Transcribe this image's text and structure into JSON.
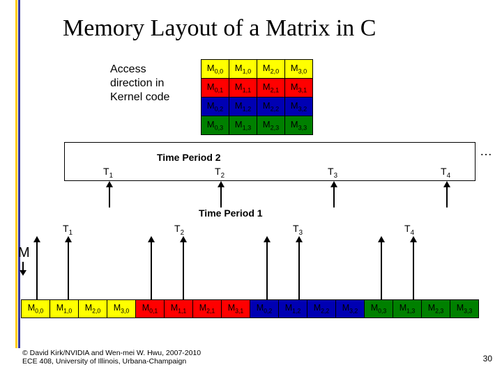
{
  "title": "Memory Layout of a Matrix in C",
  "access_label": "Access direction in Kernel code",
  "matrix_rows": [
    [
      "M0,0",
      "M1,0",
      "M2,0",
      "M3,0"
    ],
    [
      "M0,1",
      "M1,1",
      "M2,1",
      "M3,1"
    ],
    [
      "M0,2",
      "M1,2",
      "M2,2",
      "M3,2"
    ],
    [
      "M0,3",
      "M1,3",
      "M2,3",
      "M3,3"
    ]
  ],
  "tp2_label": "Time Period 2",
  "tp1_label": "Time Period 1",
  "ellipsis": "…",
  "threads": [
    "T1",
    "T2",
    "T3",
    "T4"
  ],
  "M_label": "M",
  "linear": [
    "M0,0",
    "M1,0",
    "M2,0",
    "M3,0",
    "M0,1",
    "M1,1",
    "M2,1",
    "M3,1",
    "M0,2",
    "M1,2",
    "M2,2",
    "M3,2",
    "M0,3",
    "M1,3",
    "M2,3",
    "M3,3"
  ],
  "footer_line1": "© David Kirk/NVIDIA and Wen-mei W. Hwu, 2007-2010",
  "footer_line2": "ECE 408, University of Illinois, Urbana-Champaign",
  "page_number": "30",
  "chart_data": {
    "type": "table",
    "title": "Memory Layout of a Matrix in C",
    "matrix_4x4": [
      [
        "M0,0",
        "M1,0",
        "M2,0",
        "M3,0"
      ],
      [
        "M0,1",
        "M1,1",
        "M2,1",
        "M3,1"
      ],
      [
        "M0,2",
        "M1,2",
        "M2,2",
        "M3,2"
      ],
      [
        "M0,3",
        "M1,3",
        "M2,3",
        "M3,3"
      ]
    ],
    "row_colors": [
      "#ffff00",
      "#ff0000",
      "#0000b3",
      "#008000"
    ],
    "linear_layout": [
      "M0,0",
      "M1,0",
      "M2,0",
      "M3,0",
      "M0,1",
      "M1,1",
      "M2,1",
      "M3,1",
      "M0,2",
      "M1,2",
      "M2,2",
      "M3,2",
      "M0,3",
      "M1,3",
      "M2,3",
      "M3,3"
    ],
    "linear_group_colors": [
      "#ffff00",
      "#ff0000",
      "#0000b3",
      "#008000"
    ],
    "time_periods": {
      "period1": {
        "threads": [
          "T1",
          "T2",
          "T3",
          "T4"
        ],
        "points_to_linear_indices": [
          0,
          4,
          8,
          12
        ]
      },
      "period2": {
        "threads": [
          "T1",
          "T2",
          "T3",
          "T4"
        ]
      }
    }
  }
}
